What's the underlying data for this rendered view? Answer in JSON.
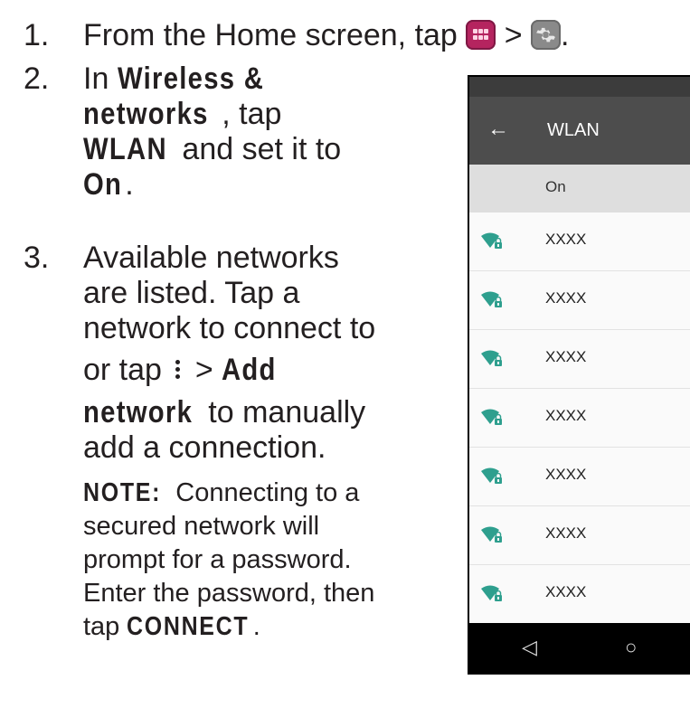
{
  "steps": [
    {
      "number": "1.",
      "text_a": "From the Home screen, tap",
      "text_b": ">",
      "text_c": "."
    },
    {
      "number": "2.",
      "l1": "In",
      "l1b": "Wireless &",
      "l2b": "networks",
      "l2": ", tap",
      "l3b": "WLAN",
      "l3": " and set it to",
      "l4b": "On",
      "l4": "."
    },
    {
      "number": "3.",
      "l1": "Available networks",
      "l2": "are listed. Tap a",
      "l3": "network to connect to",
      "l4a": "or tap",
      "l4b": " > ",
      "l4c": "Add",
      "l5b": "network",
      "l5": " to manually",
      "l6": "add a connection."
    }
  ],
  "note": {
    "label": "NOTE:",
    "l1": " Connecting to a",
    "l2": "secured network will",
    "l3": "prompt for a password.",
    "l4": "Enter the password, then",
    "l5a": "tap ",
    "l5b": "CONNECT",
    "l5c": "."
  },
  "icons": {
    "apps": "apps-icon",
    "settings": "settings-gear-icon",
    "more": "more-vert-icon",
    "wifi": "wifi-lock-icon"
  },
  "phone": {
    "title": "WLAN",
    "back_glyph": "←",
    "toggle_label": "On",
    "networks": [
      "XXXX",
      "XXXX",
      "XXXX",
      "XXXX",
      "XXXX",
      "XXXX",
      "XXXX"
    ],
    "nav": {
      "back": "◁",
      "home": "○"
    },
    "colors": {
      "appbar": "#4d4d4d",
      "wifi": "#2e9f8e"
    }
  }
}
